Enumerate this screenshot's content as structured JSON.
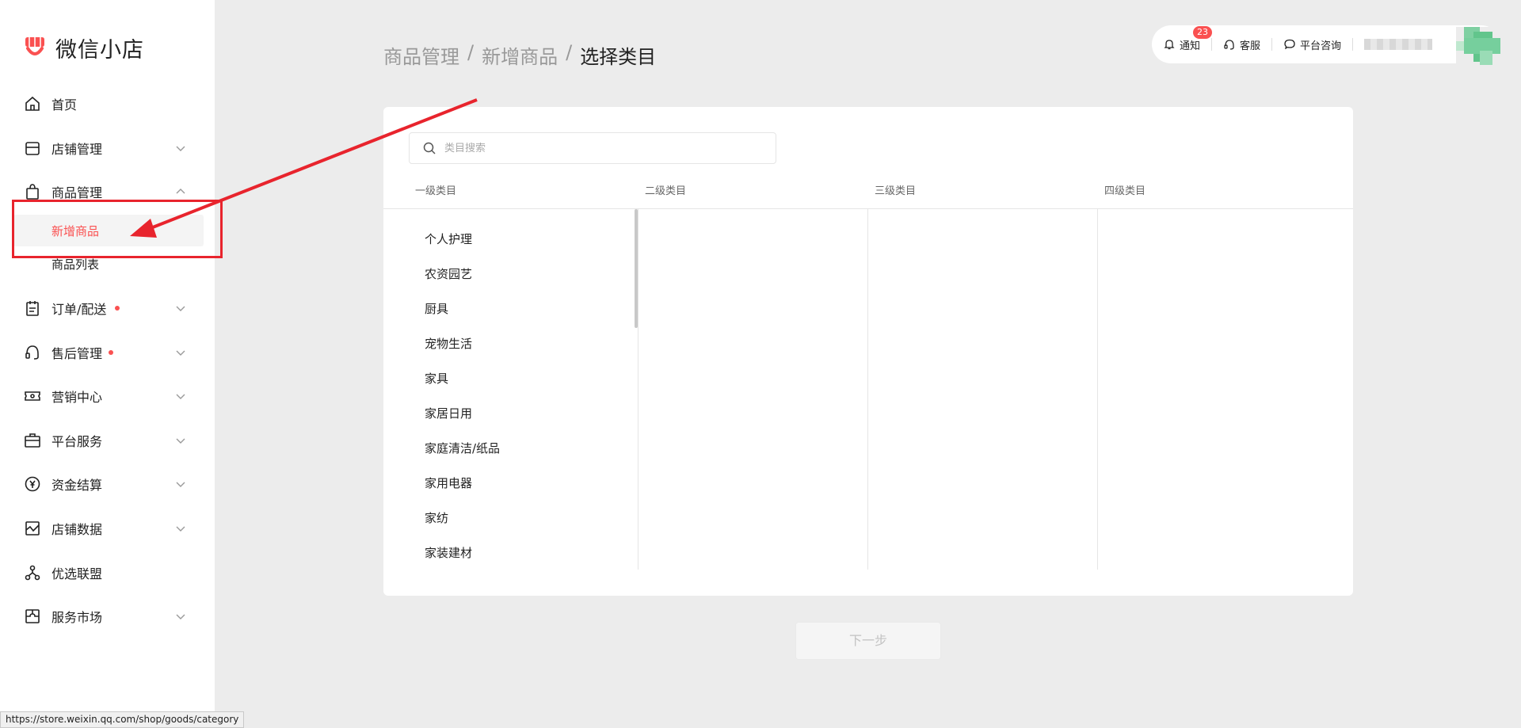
{
  "app": {
    "name": "微信小店",
    "brand_color": "#fa5151"
  },
  "sidebar": {
    "items": [
      {
        "label": "首页",
        "icon": "home-icon"
      },
      {
        "label": "店铺管理",
        "icon": "store-icon"
      },
      {
        "label": "商品管理",
        "icon": "shopping-bag-icon"
      },
      {
        "label": "订单/配送",
        "icon": "clipboard-icon",
        "has_dot": true
      },
      {
        "label": "售后管理",
        "icon": "headset-icon",
        "has_dot": true
      },
      {
        "label": "营销中心",
        "icon": "ticket-icon"
      },
      {
        "label": "平台服务",
        "icon": "briefcase-icon"
      },
      {
        "label": "资金结算",
        "icon": "yuan-coin-icon"
      },
      {
        "label": "店铺数据",
        "icon": "chart-icon"
      },
      {
        "label": "优选联盟",
        "icon": "share-nodes-icon"
      },
      {
        "label": "服务市场",
        "icon": "puzzle-icon"
      }
    ],
    "sub_items": [
      {
        "label": "新增商品",
        "active": true
      },
      {
        "label": "商品列表",
        "active": false
      }
    ]
  },
  "breadcrumb": {
    "parts": [
      "商品管理",
      "新增商品"
    ],
    "current": "选择类目",
    "separator": "/"
  },
  "topbar": {
    "notify_label": "通知",
    "notify_count": "23",
    "service_label": "客服",
    "consult_label": "平台咨询"
  },
  "search": {
    "placeholder": "类目搜索"
  },
  "columns": {
    "level1": "一级类目",
    "level2": "二级类目",
    "level3": "三级类目",
    "level4": "四级类目"
  },
  "categories": [
    "个人护理",
    "农资园艺",
    "厨具",
    "宠物生活",
    "家具",
    "家居日用",
    "家庭清洁/纸品",
    "家用电器",
    "家纺",
    "家装建材"
  ],
  "next_button": "下一步",
  "status_url": "https://store.weixin.qq.com/shop/goods/category",
  "annotation_color": "#e8242d"
}
